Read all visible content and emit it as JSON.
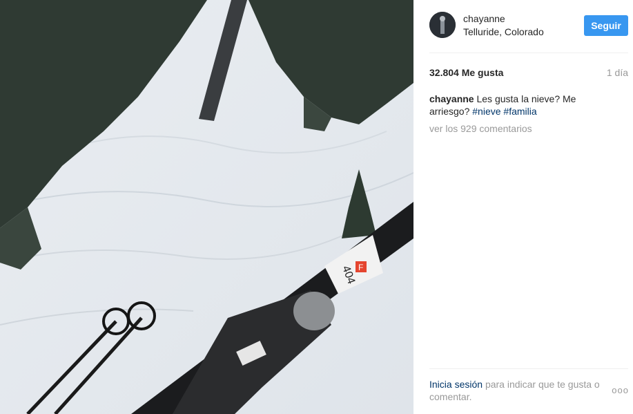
{
  "post": {
    "username": "chayanne",
    "location": "Telluride, Colorado",
    "follow_label": "Seguir",
    "likes": "32.804 Me gusta",
    "time_ago": "1 día",
    "caption": {
      "user": "chayanne",
      "text": "Les gusta la nieve? Me arriesgo?",
      "hashtags": [
        "#nieve",
        "#familia"
      ]
    },
    "comments_link": "ver los 929 comentarios",
    "footer": {
      "login_link": "Inicia sesión",
      "text": "para indicar que te gusta o comentar."
    },
    "more_label": "ooo",
    "ski_sticker": "404",
    "ski_logo": "F"
  },
  "colors": {
    "follow_bg": "#3897f0",
    "hashtag": "#003569",
    "muted": "#999999"
  }
}
